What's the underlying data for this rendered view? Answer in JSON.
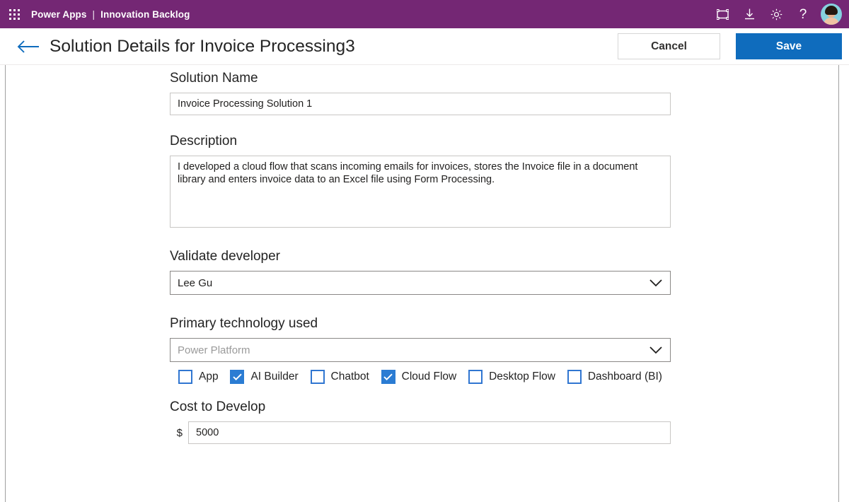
{
  "suite_bar": {
    "waffle_icon": "app-launcher-icon",
    "brand": "Power Apps",
    "separator": "|",
    "app_name": "Innovation Backlog",
    "icons": [
      {
        "name": "present-frame-icon",
        "tooltip": "Present"
      },
      {
        "name": "download-icon",
        "tooltip": "Download"
      },
      {
        "name": "gear-icon",
        "tooltip": "Settings"
      },
      {
        "name": "help-icon",
        "glyph": "?"
      }
    ],
    "avatar": "user-avatar"
  },
  "command_bar": {
    "back_icon": "back-arrow-icon",
    "title": "Solution Details for Invoice Processing3",
    "cancel_label": "Cancel",
    "save_label": "Save"
  },
  "form": {
    "solution_name": {
      "label": "Solution Name",
      "value": "Invoice Processing Solution 1",
      "placeholder": "Solution Name"
    },
    "description": {
      "label": "Description",
      "value": "I developed a cloud flow that scans incoming emails for invoices, stores the Invoice file in a document library and enters invoice data to an Excel file using Form Processing.",
      "placeholder": "Description"
    },
    "validate_developer": {
      "label": "Validate developer",
      "value": "Lee Gu",
      "is_placeholder": false
    },
    "primary_technology": {
      "label": "Primary technology used",
      "value": "Power Platform",
      "is_placeholder": true
    },
    "technology_options": [
      {
        "label": "App",
        "checked": false
      },
      {
        "label": "AI Builder",
        "checked": true
      },
      {
        "label": "Chatbot",
        "checked": false
      },
      {
        "label": "Cloud Flow",
        "checked": true
      },
      {
        "label": "Desktop Flow",
        "checked": false
      },
      {
        "label": "Dashboard (BI)",
        "checked": false
      }
    ],
    "cost_to_develop": {
      "label": "Cost to Develop",
      "currency_symbol": "$",
      "value": "5000"
    }
  },
  "colors": {
    "suite_purple": "#742774",
    "save_blue": "#0f6cbd",
    "checkbox_blue": "#2b7cd3",
    "back_arrow_blue": "#0f6cbd",
    "text_primary": "#242424"
  }
}
